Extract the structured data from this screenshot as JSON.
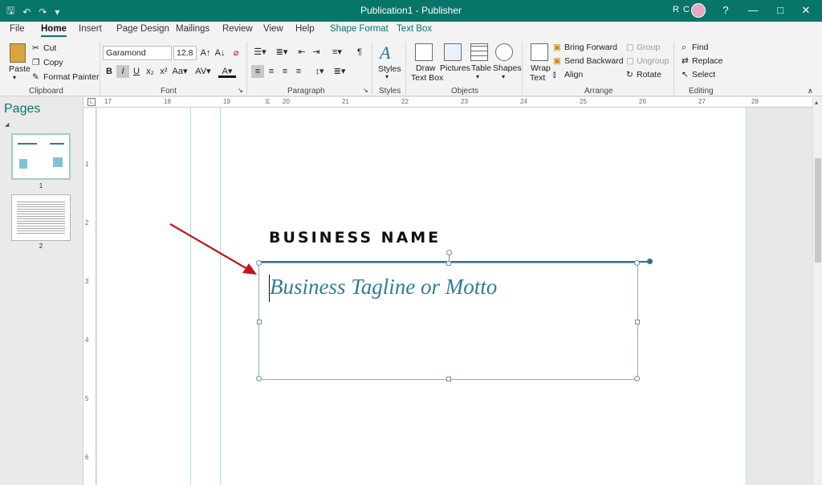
{
  "titlebar": {
    "doc_title": "Publication1  -  Publisher",
    "user_initials": "R C",
    "help": "?"
  },
  "tabs": [
    {
      "label": "File"
    },
    {
      "label": "Home"
    },
    {
      "label": "Insert"
    },
    {
      "label": "Page Design"
    },
    {
      "label": "Mailings"
    },
    {
      "label": "Review"
    },
    {
      "label": "View"
    },
    {
      "label": "Help"
    },
    {
      "label": "Shape Format"
    },
    {
      "label": "Text Box"
    }
  ],
  "clipboard": {
    "paste": "Paste",
    "cut": "Cut",
    "copy": "Copy",
    "format_painter": "Format Painter",
    "group": "Clipboard"
  },
  "font": {
    "name": "Garamond",
    "size": "12,8",
    "group": "Font"
  },
  "paragraph": {
    "group": "Paragraph"
  },
  "styles": {
    "label": "Styles",
    "group": "Styles"
  },
  "objects": {
    "draw_text_box": "Draw",
    "draw_text_box2": "Text Box",
    "pictures": "Pictures",
    "table": "Table",
    "shapes": "Shapes",
    "group": "Objects"
  },
  "arrange": {
    "wrap_text": "Wrap",
    "wrap_text2": "Text",
    "bring_forward": "Bring Forward",
    "send_backward": "Send Backward",
    "align": "Align",
    "group_btn": "Group",
    "ungroup": "Ungroup",
    "rotate": "Rotate",
    "group": "Arrange"
  },
  "editing": {
    "find": "Find",
    "replace": "Replace",
    "select": "Select",
    "group": "Editing"
  },
  "pages_pane": {
    "title": "Pages",
    "page1": "1",
    "page2": "2"
  },
  "ruler": {
    "h_marks": [
      "17",
      "18",
      "19",
      "20",
      "21",
      "22",
      "23",
      "24",
      "25",
      "26",
      "27",
      "28"
    ],
    "v_marks": [
      "1",
      "2",
      "3",
      "4",
      "5",
      "6"
    ]
  },
  "document": {
    "business_name": "BUSINESS NAME",
    "tagline": "Business Tagline or Motto"
  },
  "colors": {
    "accent": "#077568",
    "tagline": "#2d7d9a",
    "arrow": "#c0161c"
  }
}
